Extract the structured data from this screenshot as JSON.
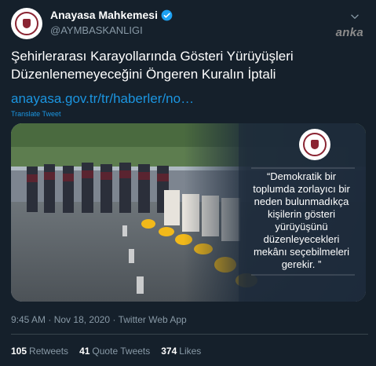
{
  "account": {
    "name": "Anayasa Mahkemesi",
    "handle": "@AYMBASKANLIGI",
    "verified_icon": "verified-badge-icon",
    "menu_icon": "chevron-down-icon"
  },
  "watermark": "anka",
  "tweet": {
    "text_lines": [
      "Şehirlerarası Karayollarında Gösteri Yürüyüşleri",
      "Düzenlenemeyeceğini Öngeren Kuralın İptali"
    ],
    "link": "anayasa.gov.tr/tr/haberler/no…",
    "translate_label": "Translate Tweet"
  },
  "media": {
    "quote_lines": [
      "“Demokratik bir",
      "toplumda zorlayıcı bir",
      "neden bulunmadıkça",
      "kişilerin gösteri",
      "yürüyüşünü",
      "düzenleyecekleri",
      "mekânı seçebilmeleri",
      "gerekir. ”"
    ]
  },
  "meta": {
    "time": "9:45 AM",
    "date": "Nov 18, 2020",
    "source": "Twitter Web App",
    "separator": "·"
  },
  "stats": {
    "retweets_count": "105",
    "retweets_label": "Retweets",
    "quotes_count": "41",
    "quotes_label": "Quote Tweets",
    "likes_count": "374",
    "likes_label": "Likes"
  },
  "colors": {
    "background": "#15202b",
    "link": "#1b95e0",
    "secondary_text": "#8899a6"
  }
}
